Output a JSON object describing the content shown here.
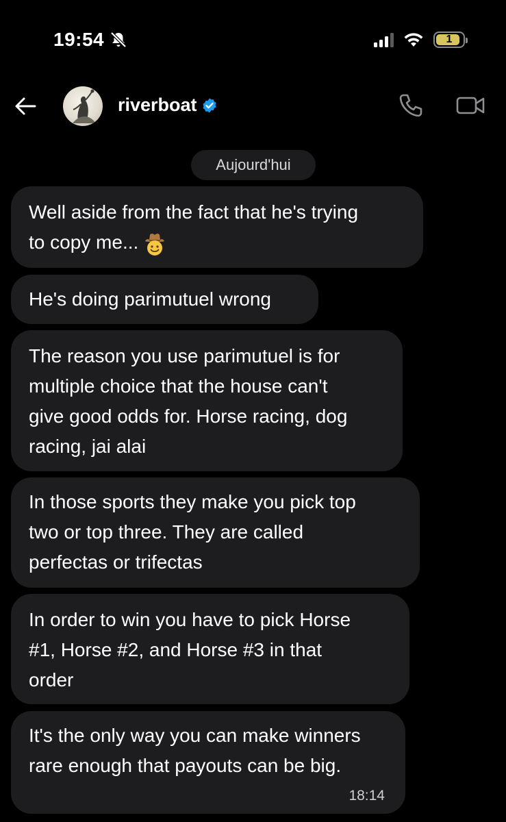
{
  "status_bar": {
    "time": "19:54",
    "battery_level": "1",
    "icons": [
      "bell-muted-icon",
      "cellular-signal-icon",
      "wifi-icon",
      "battery-icon"
    ]
  },
  "header": {
    "username": "riverboat",
    "verified": true,
    "icons": [
      "back-arrow-icon",
      "phone-icon",
      "video-camera-icon",
      "verified-badge-icon"
    ]
  },
  "conversation": {
    "date_label": "Aujourd'hui",
    "messages": [
      {
        "text": "Well aside from the fact that he's trying\nto copy me...",
        "emoji": "cowboy-face-icon"
      },
      {
        "text": "He's doing parimutuel wrong"
      },
      {
        "text": "The reason you use parimutuel is for\nmultiple choice that the house can't\ngive good odds for. Horse racing, dog\nracing, jai alai"
      },
      {
        "text": "In those sports they make you pick top\ntwo or top three. They are called\nperfectas or trifectas"
      },
      {
        "text": "In order to win you have to pick Horse\n#1, Horse #2, and Horse #3 in that\norder"
      },
      {
        "text": "It's the only way you can make winners\nrare enough that payouts can be big.",
        "time": "18:14"
      }
    ]
  },
  "colors": {
    "background": "#000000",
    "bubble": "#1d1d20",
    "verified_blue": "#1d9bf0",
    "battery_yellow": "#d7c55f"
  }
}
